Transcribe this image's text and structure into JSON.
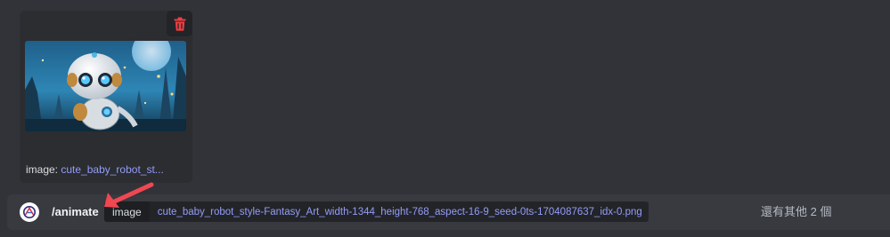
{
  "attachment": {
    "label": "image:",
    "filename_truncated": "cute_baby_robot_st...",
    "thumbnail_alt": "cute baby robot fantasy art",
    "delete_icon": "trash-icon"
  },
  "command": {
    "name": "/animate",
    "bot_avatar_icon": "bot-logo-icon",
    "option": {
      "name": "image",
      "value": "cute_baby_robot_style-Fantasy_Art_width-1344_height-768_aspect-16-9_seed-0ts-1704087637_idx-0.png"
    },
    "more_options": "還有其他 2 個"
  },
  "annotation": {
    "arrow_icon": "red-arrow-icon"
  },
  "colors": {
    "background": "#313338",
    "card": "#2b2d31",
    "command_bar": "#383a40",
    "link": "#949cf7",
    "danger": "#f23f42",
    "arrow": "#f04752"
  }
}
